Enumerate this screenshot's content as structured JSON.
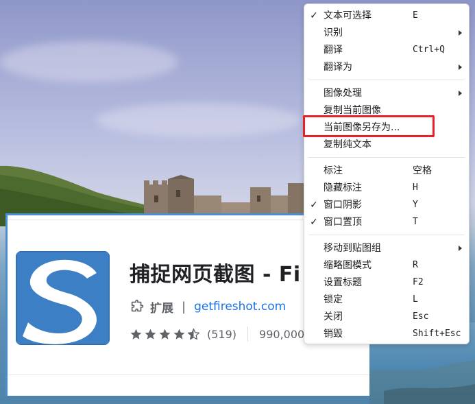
{
  "extension_card": {
    "title": "捕捉网页截图 - Fi",
    "type_label": "扩展",
    "separator": "|",
    "website": "getfireshot.com",
    "rating": 4.5,
    "rating_count": "(519)",
    "users": "990,000"
  },
  "context_menu": {
    "items": [
      {
        "label": "文本可选择",
        "shortcut": "E",
        "checked": true,
        "submenu": false
      },
      {
        "label": "识别",
        "shortcut": "",
        "checked": false,
        "submenu": true
      },
      {
        "label": "翻译",
        "shortcut": "Ctrl+Q",
        "checked": false,
        "submenu": false
      },
      {
        "label": "翻译为",
        "shortcut": "",
        "checked": false,
        "submenu": true
      },
      {
        "label": "图像处理",
        "shortcut": "",
        "checked": false,
        "submenu": true
      },
      {
        "label": "复制当前图像",
        "shortcut": "",
        "checked": false,
        "submenu": false
      },
      {
        "label": "当前图像另存为...",
        "shortcut": "",
        "checked": false,
        "submenu": false
      },
      {
        "label": "复制纯文本",
        "shortcut": "",
        "checked": false,
        "submenu": false
      },
      {
        "label": "标注",
        "shortcut": "空格",
        "checked": false,
        "submenu": false
      },
      {
        "label": "隐藏标注",
        "shortcut": "H",
        "checked": false,
        "submenu": false
      },
      {
        "label": "窗口阴影",
        "shortcut": "Y",
        "checked": true,
        "submenu": false
      },
      {
        "label": "窗口置顶",
        "shortcut": "T",
        "checked": true,
        "submenu": false
      },
      {
        "label": "移动到贴图组",
        "shortcut": "",
        "checked": false,
        "submenu": true
      },
      {
        "label": "缩略图模式",
        "shortcut": "R",
        "checked": false,
        "submenu": false
      },
      {
        "label": "设置标题",
        "shortcut": "F2",
        "checked": false,
        "submenu": false
      },
      {
        "label": "锁定",
        "shortcut": "L",
        "checked": false,
        "submenu": false
      },
      {
        "label": "关闭",
        "shortcut": "Esc",
        "checked": false,
        "submenu": false
      },
      {
        "label": "销毁",
        "shortcut": "Shift+Esc",
        "checked": false,
        "submenu": false
      }
    ],
    "check_glyph": "✓"
  },
  "colors": {
    "highlight": "#e8202a",
    "link": "#1a73e8",
    "card_border": "#4a8ed8"
  }
}
